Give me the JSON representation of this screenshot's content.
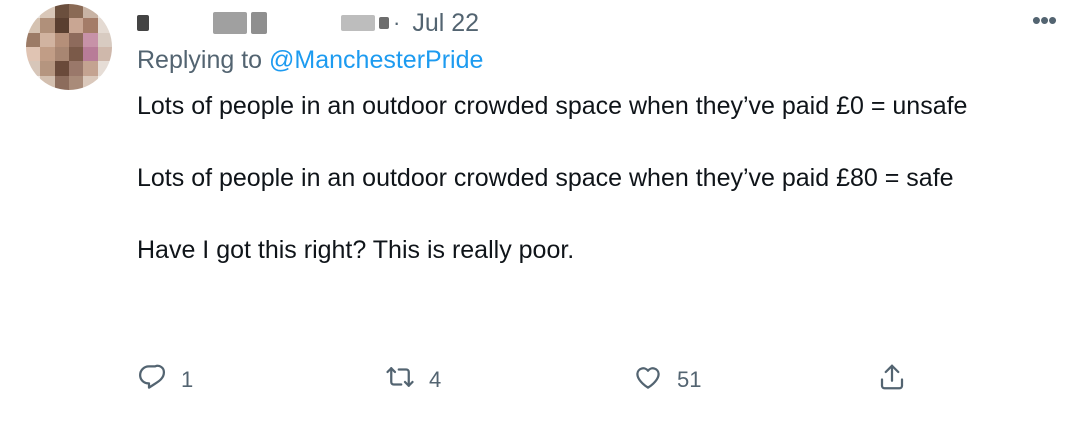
{
  "tweet": {
    "date": "Jul 22",
    "replying_prefix": "Replying to",
    "replying_handle": "@ManchesterPride",
    "paragraphs": [
      "Lots of people in an outdoor crowded space when they’ve paid £0 = unsafe",
      "Lots of people in an outdoor crowded space when they’ve paid £80 = safe",
      "Have I got this right? This is really poor."
    ],
    "actions": {
      "reply_count": "1",
      "retweet_count": "4",
      "like_count": "51",
      "share_count": ""
    },
    "more_menu_glyph": "•••"
  },
  "icons": {
    "reply": "speech-bubble-icon",
    "retweet": "retweet-arrows-icon",
    "like": "heart-icon",
    "share": "share-upload-icon",
    "more": "more-dots-icon"
  },
  "colors": {
    "text": "#0f1419",
    "secondary": "#536471",
    "link": "#1d9bf0",
    "background": "#ffffff"
  }
}
